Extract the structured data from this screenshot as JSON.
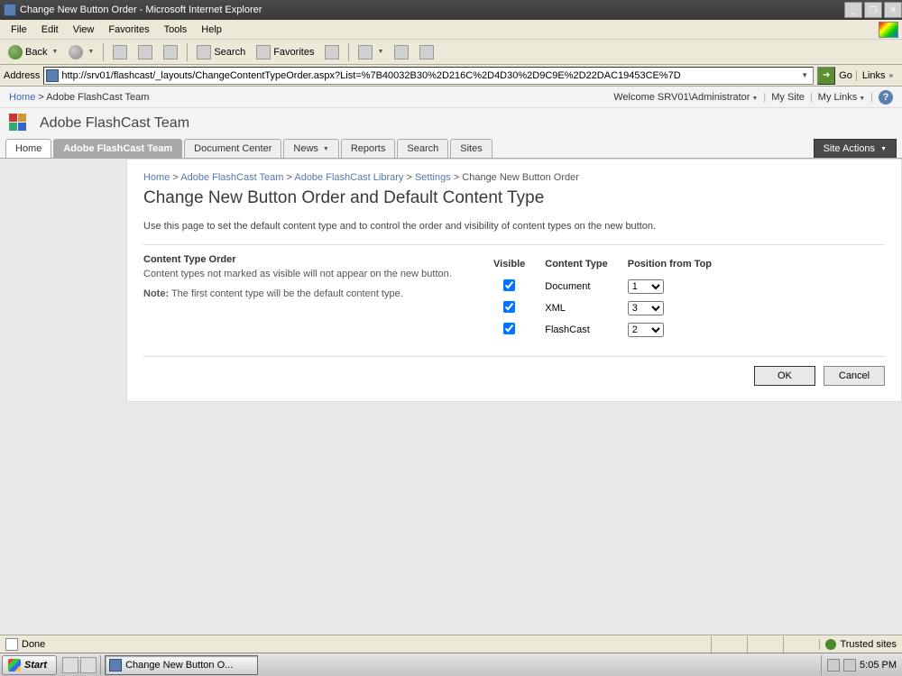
{
  "window": {
    "title": "Change New Button Order - Microsoft Internet Explorer",
    "min": "_",
    "max": "❐",
    "close": "✕"
  },
  "menubar": [
    "File",
    "Edit",
    "View",
    "Favorites",
    "Tools",
    "Help"
  ],
  "toolbar": {
    "back": "Back",
    "search": "Search",
    "favorites": "Favorites"
  },
  "addressbar": {
    "label": "Address",
    "url": "http://srv01/flashcast/_layouts/ChangeContentTypeOrder.aspx?List=%7B40032B30%2D216C%2D4D30%2D9C9E%2D22DAC19453CE%7D",
    "go": "Go",
    "links": "Links"
  },
  "sp_top": {
    "home": "Home",
    "crumb": "Adobe FlashCast Team",
    "welcome": "Welcome SRV01\\Administrator",
    "mysite": "My Site",
    "mylinks": "My Links"
  },
  "site_title": "Adobe FlashCast Team",
  "tabs": [
    "Home",
    "Adobe FlashCast Team",
    "Document Center",
    "News",
    "Reports",
    "Search",
    "Sites"
  ],
  "site_actions": "Site Actions",
  "breadcrumb": {
    "p1": "Home",
    "p2": "Adobe FlashCast Team",
    "p3": "Adobe FlashCast Library",
    "p4": "Settings",
    "p5": "Change New Button Order"
  },
  "page": {
    "heading": "Change New Button Order and Default Content Type",
    "description": "Use this page to set the default content type and to control the order and visibility of content types on the new button.",
    "section_title": "Content Type Order",
    "section_desc": "Content types not marked as visible will not appear on the new button.",
    "note_label": "Note:",
    "note_text": " The first content type will be the default content type."
  },
  "table": {
    "h_visible": "Visible",
    "h_type": "Content Type",
    "h_pos": "Position from Top",
    "rows": [
      {
        "name": "Document",
        "visible": true,
        "position": "1"
      },
      {
        "name": "XML",
        "visible": true,
        "position": "3"
      },
      {
        "name": "FlashCast",
        "visible": true,
        "position": "2"
      }
    ],
    "options": [
      "1",
      "2",
      "3"
    ]
  },
  "buttons": {
    "ok": "OK",
    "cancel": "Cancel"
  },
  "status": {
    "text": "Done",
    "trusted": "Trusted sites"
  },
  "taskbar": {
    "start": "Start",
    "task": "Change New Button O...",
    "clock": "5:05 PM"
  }
}
